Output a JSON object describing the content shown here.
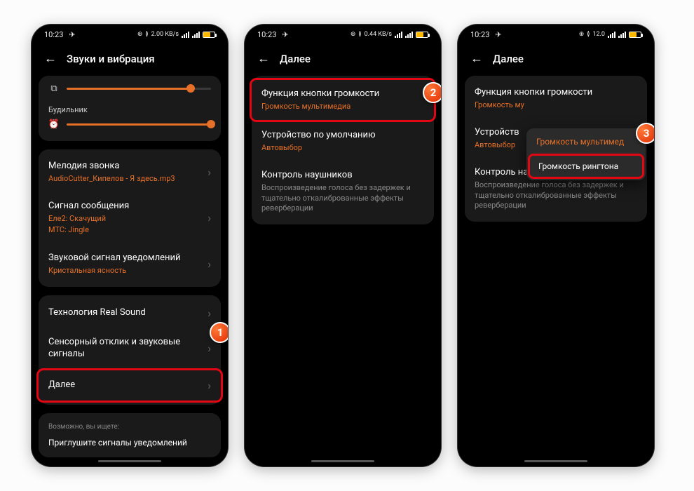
{
  "status": {
    "time": "10:23",
    "speed_label": "0.44 KB/s",
    "speed_label2": "2.00 KB/s",
    "speed_label3": "12.0"
  },
  "colors": {
    "accent": "#e67028",
    "highlight": "#e30613"
  },
  "screen1": {
    "title": "Звуки и вибрация",
    "alarm_label": "Будильник",
    "ringtone": {
      "title": "Мелодия звонка",
      "sub": "AudioCutter_Кипелов - Я здесь.mp3"
    },
    "message": {
      "title": "Сигнал сообщения",
      "sub1": "Еле2: Скачущий",
      "sub2": "МТС: Jingle"
    },
    "notify": {
      "title": "Звуковой сигнал уведомлений",
      "sub": "Кристальная ясность"
    },
    "realsound": "Технология Real Sound",
    "touch": "Сенсорный отклик и звуковые сигналы",
    "more": "Далее",
    "search_hint": "Возможно, вы ищете:",
    "search_item": "Приглушите сигналы уведомлений"
  },
  "screen2": {
    "title": "Далее",
    "volfn": {
      "title": "Функция кнопки громкости",
      "sub": "Громкость мультимедиа"
    },
    "defdev": {
      "title": "Устройство по умолчанию",
      "sub": "Автовыбор"
    },
    "headctl": {
      "title": "Контроль наушников",
      "sub": "Воспроизведение голоса без задержек и тщательно откалиброванные эффекты реверберации"
    }
  },
  "screen3": {
    "title": "Далее",
    "volfn": {
      "title": "Функция кнопки громкости",
      "sub": "Громкость му"
    },
    "defdev": {
      "title": "Устройств",
      "sub": "Автовыбор"
    },
    "headctl": {
      "title": "Контроль наушников",
      "sub": "Воспроизведение голоса без задержек и тщательно откалиброванные эффекты реверберации"
    },
    "popup": {
      "opt1": "Громкость мультимед",
      "opt2": "Громкость рингтона"
    }
  },
  "steps": {
    "s1": "1",
    "s2": "2",
    "s3": "3"
  }
}
